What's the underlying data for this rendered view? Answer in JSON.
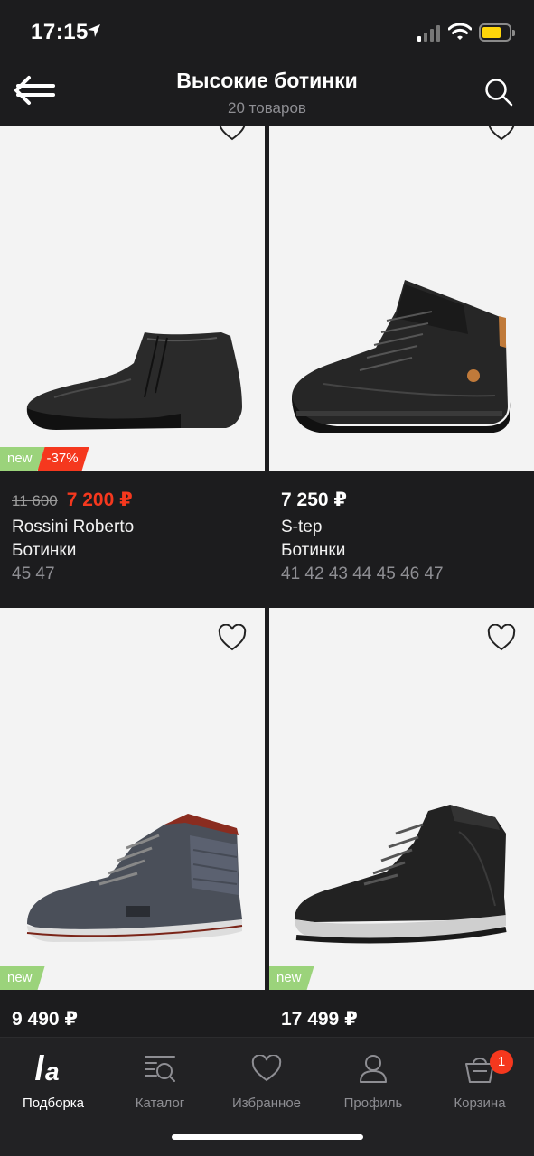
{
  "status_bar": {
    "time": "17:15"
  },
  "header": {
    "title": "Высокие ботинки",
    "subtitle": "20 товаров"
  },
  "products": [
    {
      "badge_new": "new",
      "badge_discount": "-37%",
      "old_price": "11 600",
      "price": "7 200 ₽",
      "brand": "Rossini Roberto",
      "category": "Ботинки",
      "sizes": "45 47"
    },
    {
      "price": "7 250 ₽",
      "brand": "S-tep",
      "category": "Ботинки",
      "sizes": "41 42 43 44 45 46 47"
    },
    {
      "badge_new": "new",
      "price": "9 490 ₽"
    },
    {
      "badge_new": "new",
      "price": "17 499 ₽"
    }
  ],
  "tabbar": {
    "items": [
      {
        "label": "Подборка",
        "icon": "la-logo-icon",
        "active": true
      },
      {
        "label": "Каталог",
        "icon": "catalog-icon"
      },
      {
        "label": "Избранное",
        "icon": "heart-icon"
      },
      {
        "label": "Профиль",
        "icon": "profile-icon"
      },
      {
        "label": "Корзина",
        "icon": "cart-icon",
        "badge": "1"
      }
    ]
  },
  "colors": {
    "sale_red": "#f5381e",
    "new_green": "#9bd37b",
    "background": "#1c1c1e",
    "card_bg": "#f3f3f3"
  }
}
